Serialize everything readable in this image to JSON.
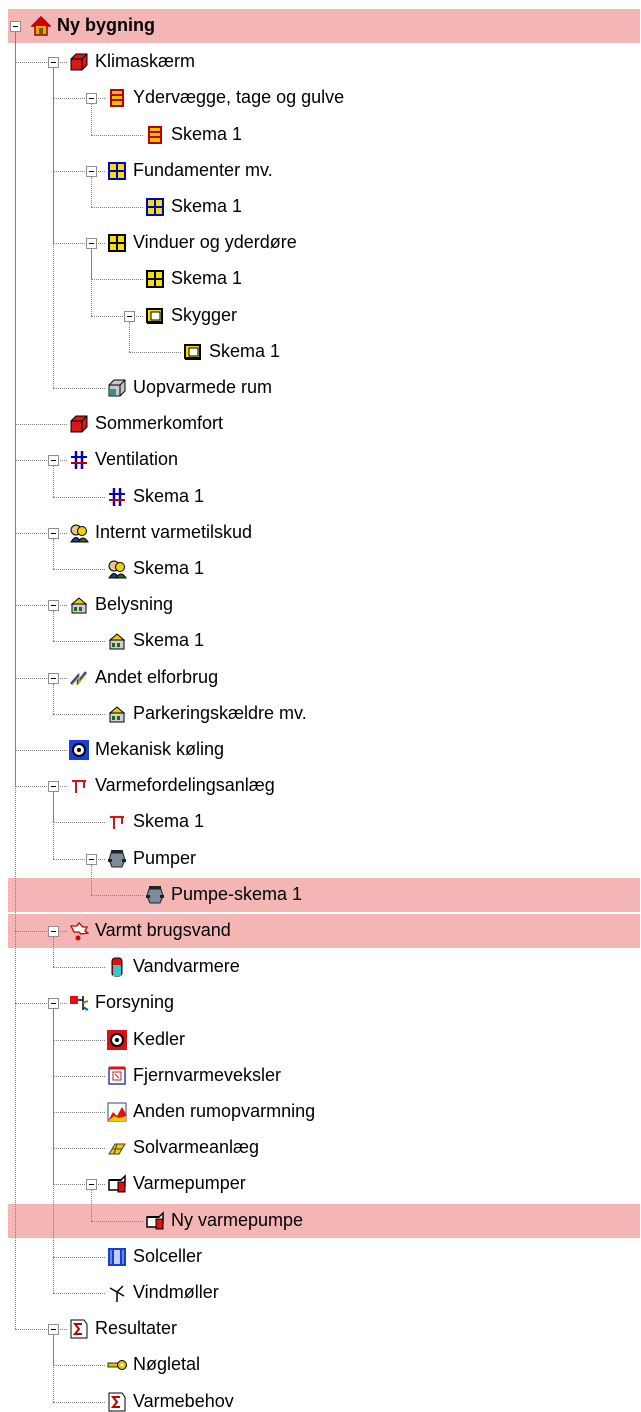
{
  "tree": {
    "highlight_color": "#f4b5b5",
    "nodes": [
      {
        "label": "Ny bygning",
        "icon": "house-icon",
        "depth": 0,
        "selected": true,
        "expander": true
      },
      {
        "label": "Klimaskærm",
        "icon": "red-cube-icon",
        "depth": 1,
        "expander": true
      },
      {
        "label": "Ydervægge, tage og gulve",
        "icon": "wall-layers-icon",
        "depth": 2,
        "expander": true
      },
      {
        "label": "Skema 1",
        "icon": "wall-layers-icon",
        "depth": 3
      },
      {
        "label": "Fundamenter mv.",
        "icon": "grid-window-icon",
        "depth": 2,
        "expander": true
      },
      {
        "label": "Skema 1",
        "icon": "grid-window-icon",
        "depth": 3
      },
      {
        "label": "Vinduer og yderdøre",
        "icon": "yellow-window-icon",
        "depth": 2,
        "expander": true
      },
      {
        "label": "Skema 1",
        "icon": "yellow-window-icon",
        "depth": 3
      },
      {
        "label": "Skygger",
        "icon": "shade-icon",
        "depth": 3,
        "expander": true
      },
      {
        "label": "Skema 1",
        "icon": "shade-icon",
        "depth": 4
      },
      {
        "label": "Uopvarmede rum",
        "icon": "grey-cube-icon",
        "depth": 2
      },
      {
        "label": "Sommerkomfort",
        "icon": "red-cube-icon",
        "depth": 1
      },
      {
        "label": "Ventilation",
        "icon": "ventilation-icon",
        "depth": 1,
        "expander": true
      },
      {
        "label": "Skema 1",
        "icon": "ventilation-icon",
        "depth": 2
      },
      {
        "label": "Internt varmetilskud",
        "icon": "people-icon",
        "depth": 1,
        "expander": true
      },
      {
        "label": "Skema 1",
        "icon": "people-icon",
        "depth": 2
      },
      {
        "label": "Belysning",
        "icon": "lighting-icon",
        "depth": 1,
        "expander": true
      },
      {
        "label": "Skema 1",
        "icon": "lighting-icon",
        "depth": 2
      },
      {
        "label": "Andet elforbrug",
        "icon": "lightning-icon",
        "depth": 1,
        "expander": true
      },
      {
        "label": "Parkeringskældre mv.",
        "icon": "lighting-icon",
        "depth": 2
      },
      {
        "label": "Mekanisk køling",
        "icon": "cooling-icon",
        "depth": 1
      },
      {
        "label": "Varmefordelingsanlæg",
        "icon": "pipe-icon",
        "depth": 1,
        "expander": true
      },
      {
        "label": "Skema 1",
        "icon": "pipe-icon",
        "depth": 2
      },
      {
        "label": "Pumper",
        "icon": "pump-icon",
        "depth": 2,
        "expander": true
      },
      {
        "label": "Pumpe-skema 1",
        "icon": "pump-icon",
        "depth": 3,
        "selected": true
      },
      {
        "label": "Varmt brugsvand",
        "icon": "water-tap-icon",
        "depth": 1,
        "expander": true,
        "selected": true
      },
      {
        "label": "Vandvarmere",
        "icon": "water-heater-icon",
        "depth": 2
      },
      {
        "label": "Forsyning",
        "icon": "supply-icon",
        "depth": 1,
        "expander": true
      },
      {
        "label": "Kedler",
        "icon": "boiler-icon",
        "depth": 2
      },
      {
        "label": "Fjernvarmeveksler",
        "icon": "heat-exchanger-icon",
        "depth": 2
      },
      {
        "label": "Anden rumopvarmning",
        "icon": "chart-heating-icon",
        "depth": 2
      },
      {
        "label": "Solvarmeanlæg",
        "icon": "solar-collector-icon",
        "depth": 2
      },
      {
        "label": "Varmepumper",
        "icon": "heat-pump-icon",
        "depth": 2,
        "expander": true
      },
      {
        "label": "Ny varmepumpe",
        "icon": "heat-pump-icon",
        "depth": 3,
        "selected": true
      },
      {
        "label": "Solceller",
        "icon": "solar-cell-icon",
        "depth": 2
      },
      {
        "label": "Vindmøller",
        "icon": "wind-turbine-icon",
        "depth": 2
      },
      {
        "label": "Resultater",
        "icon": "sigma-icon",
        "depth": 1,
        "expander": true
      },
      {
        "label": "Nøgletal",
        "icon": "key-icon",
        "depth": 2
      },
      {
        "label": "Varmebehov",
        "icon": "sigma-icon",
        "depth": 2
      }
    ]
  }
}
